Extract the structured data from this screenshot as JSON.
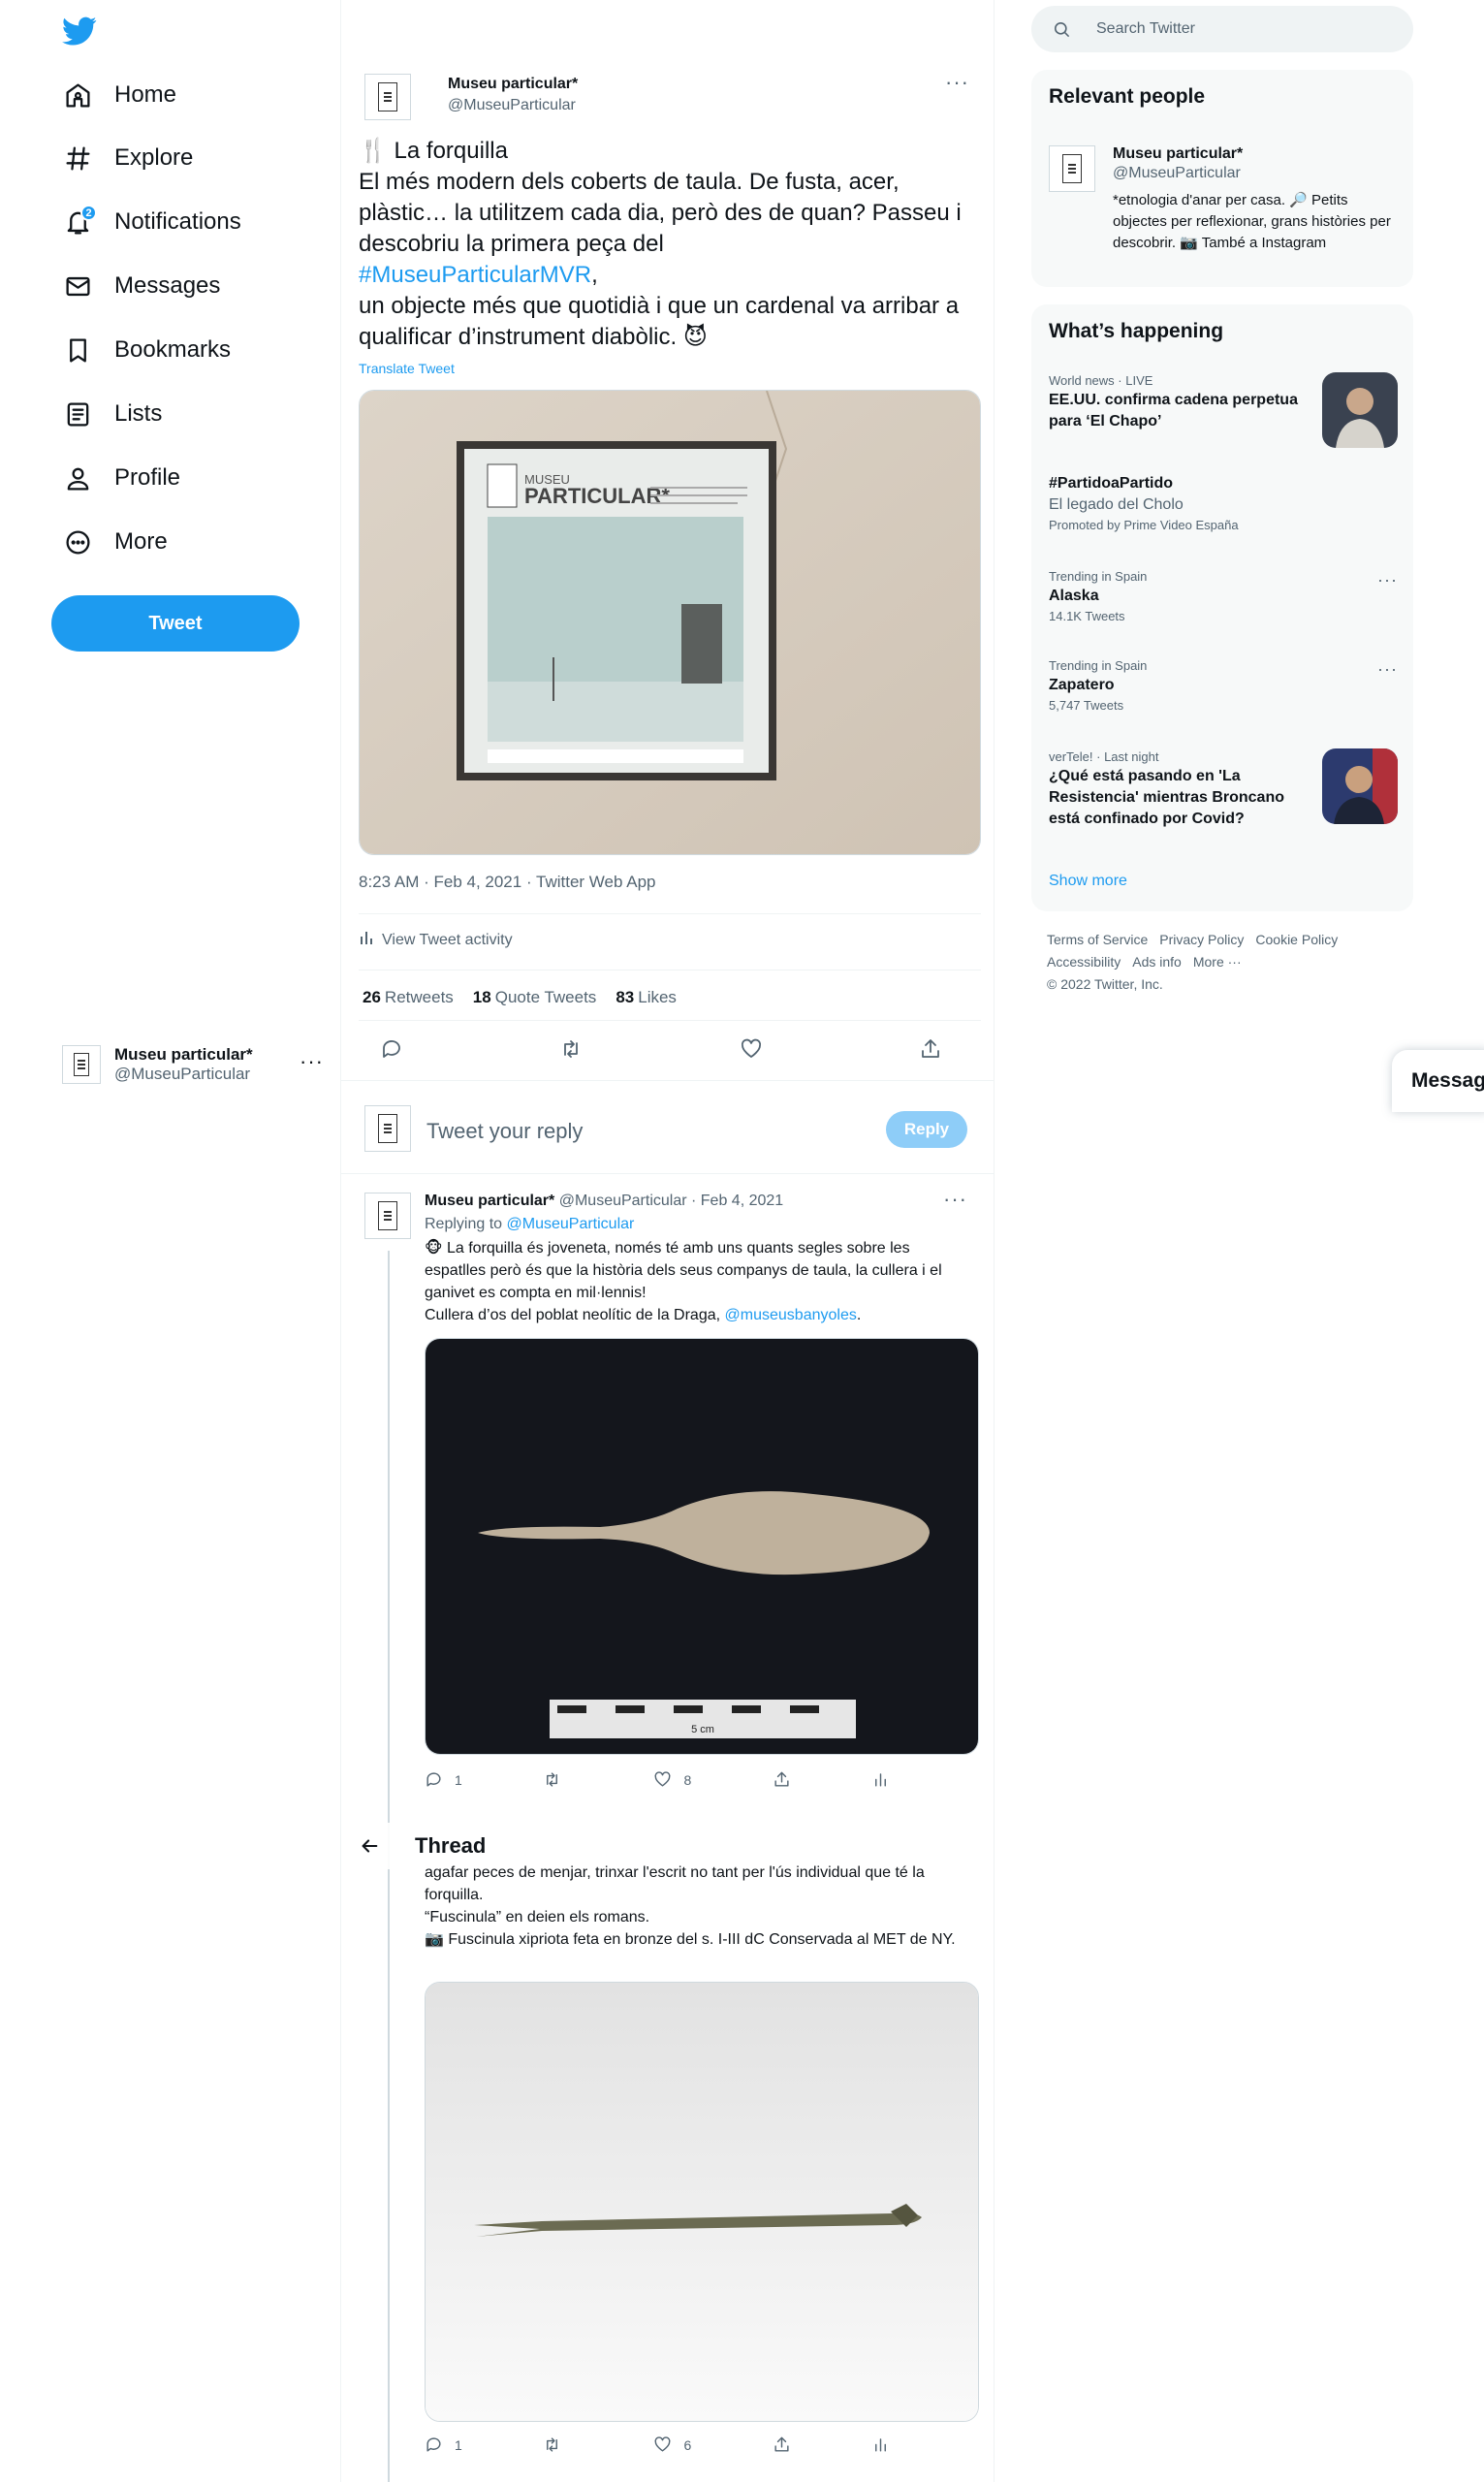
{
  "colors": {
    "accent": "#1d9bf0",
    "text": "#0f1419",
    "muted": "#536471"
  },
  "nav": {
    "items": [
      {
        "label": "Home",
        "icon": "home-icon"
      },
      {
        "label": "Explore",
        "icon": "hashtag-icon"
      },
      {
        "label": "Notifications",
        "icon": "bell-icon",
        "badge": "2"
      },
      {
        "label": "Messages",
        "icon": "envelope-icon"
      },
      {
        "label": "Bookmarks",
        "icon": "bookmark-icon"
      },
      {
        "label": "Lists",
        "icon": "list-icon"
      },
      {
        "label": "Profile",
        "icon": "person-icon"
      },
      {
        "label": "More",
        "icon": "more-circle-icon"
      }
    ],
    "tweet_button": "Tweet"
  },
  "account": {
    "name": "Museu particular*",
    "handle": "@MuseuParticular",
    "more": "···"
  },
  "tweet": {
    "name": "Museu particular*",
    "handle": "@MuseuParticular",
    "more": "···",
    "text_pre": "🍴 La forquilla\nEl més modern dels coberts de taula. De fusta, acer, plàstic… la utilitzem cada dia, però des de quan? Passeu i descobriu la primera peça del\n",
    "hashtag": "#MuseuParticularMVR",
    "text_post": ",\nun objecte més que quotidià i que un cardenal va arribar a qualificar d’instrument diabòlic. 😈",
    "translate": "Translate Tweet",
    "image_text": "MUSEU PARTICULAR*",
    "meta": "8:23 AM · Feb 4, 2021 · Twitter Web App",
    "activity": "View Tweet activity",
    "stats": [
      {
        "value": "26",
        "label": "Retweets"
      },
      {
        "value": "18",
        "label": "Quote Tweets"
      },
      {
        "value": "83",
        "label": "Likes"
      }
    ]
  },
  "reply_box": {
    "placeholder": "Tweet your reply",
    "button": "Reply"
  },
  "replies": [
    {
      "name": "Museu particular*",
      "handle_time": "@MuseuParticular · Feb 4, 2021",
      "replying_prefix": "Replying to",
      "replying_to": "@MuseuParticular",
      "text": "🐵 La forquilla és joveneta, només té amb uns quants segles sobre les espatlles però és que la història dels seus companys de taula, la cullera i el ganivet es compta en mil·lennis!\nCullera d’os del poblat neolític de la Draga,",
      "mention": "@museusbanyoles",
      "text_end": ".",
      "scale_label": "5 cm",
      "reply_count": "1",
      "retweet_count": "",
      "like_count": "8"
    },
    {
      "text": "agafar peces de menjar, trinxar l'escrit no tant per l'ús individual que té la forquilla.\n“Fuscinula” en deien els romans.\n📷 Fuscinula xipriota feta en bronze del s. I-III dC Conservada al MET de NY.",
      "reply_count": "1",
      "retweet_count": "",
      "like_count": "6"
    }
  ],
  "thread_header": {
    "title": "Thread"
  },
  "search": {
    "placeholder": "Search Twitter"
  },
  "relevant_people": {
    "title": "Relevant people",
    "name": "Museu particular*",
    "handle": "@MuseuParticular",
    "bio": "*etnologia d'anar per casa. 🔎 Petits objectes per reflexionar, grans històries per descobrir. 📷 També a Instagram"
  },
  "happening": {
    "title": "What’s happening",
    "trends": [
      {
        "context": "World news · LIVE",
        "title": "EE.UU. confirma cadena perpetua para ‘El Chapo’",
        "sub": "",
        "count": ""
      },
      {
        "context": "",
        "title": "#PartidoaPartido",
        "sub": "El legado del Cholo",
        "count": "Promoted by Prime Video España"
      },
      {
        "context": "Trending in Spain",
        "title": "Alaska",
        "sub": "",
        "count": "14.1K Tweets"
      },
      {
        "context": "Trending in Spain",
        "title": "Zapatero",
        "sub": "",
        "count": "5,747 Tweets"
      },
      {
        "context": "verTele! · Last night",
        "title": "¿Qué está pasando en 'La Resistencia' mientras Broncano está confinado por Covid?",
        "sub": "",
        "count": ""
      }
    ],
    "show_more": "Show more"
  },
  "footer": {
    "links": [
      "Terms of Service",
      "Privacy Policy",
      "Cookie Policy",
      "Accessibility",
      "Ads info",
      "More ···"
    ],
    "copyright": "© 2022 Twitter, Inc."
  },
  "messages_drawer": "Messages"
}
